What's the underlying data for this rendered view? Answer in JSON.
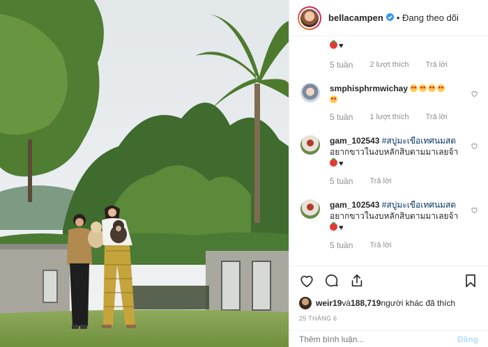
{
  "header": {
    "username": "bellacampen",
    "follow_status": "Đang theo dõi",
    "verified": true
  },
  "comments": [
    {
      "partial": true,
      "emoji": [
        "tomato",
        "heart"
      ],
      "time": "5 tuần",
      "likes": "2 lượt thích",
      "reply": "Trả lời"
    },
    {
      "user": "smphisphrmwichay",
      "emoji": [
        "heart-eyes",
        "heart-eyes",
        "heart-eyes",
        "heart-eyes",
        "heart-eyes"
      ],
      "time": "5 tuần",
      "likes": "1 lượt thích",
      "reply": "Trả lời"
    },
    {
      "user": "gam_102543",
      "hashtag": "#สบู่มะเขือเทศนมสด",
      "text": "อยากขาวในงบหลักสิบตามมาเลยจ้า",
      "emoji": [
        "tomato",
        "heart"
      ],
      "time": "5 tuần",
      "reply": "Trả lời"
    },
    {
      "user": "gam_102543",
      "hashtag": "#สบู่มะเขือเทศนมสด",
      "text": "อยากขาวในงบหลักสิบตามมาเลยจ้า",
      "emoji": [
        "tomato",
        "heart"
      ],
      "time": "5 tuần",
      "reply": "Trả lời"
    }
  ],
  "actions": {
    "like_icon": "heart-outline-icon",
    "comment_icon": "comment-icon",
    "share_icon": "share-icon",
    "save_icon": "bookmark-icon"
  },
  "likes": {
    "first_user": "weir19",
    "connector": " và ",
    "count": "188,719",
    "suffix": " người khác đã thích"
  },
  "date": "25 THÁNG 6",
  "comment_box": {
    "placeholder": "Thêm bình luận...",
    "post_label": "Đăng"
  },
  "colors": {
    "verified_blue": "#3897f0",
    "link_blue": "#003569",
    "muted": "#8e8e8e",
    "post_disabled": "#b2dffc"
  }
}
